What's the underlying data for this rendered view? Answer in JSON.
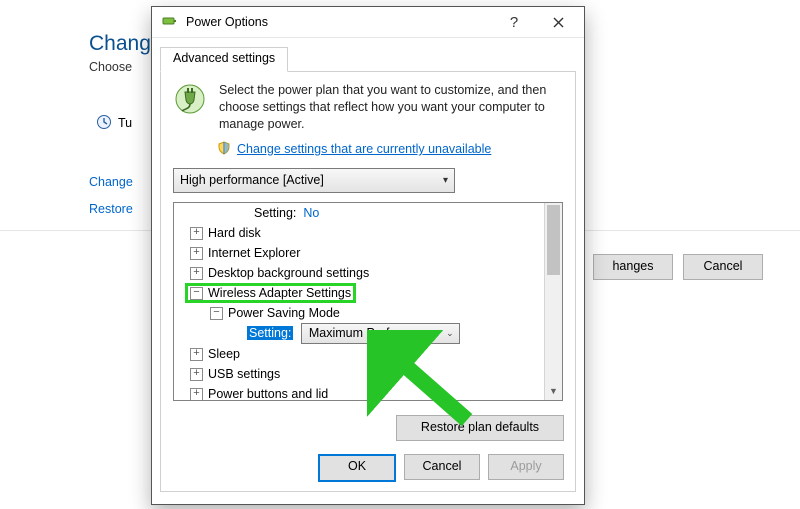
{
  "background": {
    "title": "Chang",
    "subtitle": "Choose",
    "turn_label": "Tu",
    "link_change": "Change",
    "link_restore": "Restore",
    "btn_save": "hanges",
    "btn_cancel": "Cancel"
  },
  "dialog": {
    "title": "Power Options",
    "tab": "Advanced settings",
    "description": "Select the power plan that you want to customize, and then choose settings that reflect how you want your computer to manage power.",
    "uac_link": "Change settings that are currently unavailable",
    "plan_selected": "High performance [Active]",
    "restore_btn": "Restore plan defaults",
    "ok": "OK",
    "cancel": "Cancel",
    "apply": "Apply"
  },
  "tree": {
    "row0_label": "Setting:",
    "row0_value": "No",
    "items": [
      "Hard disk",
      "Internet Explorer",
      "Desktop background settings",
      "Wireless Adapter Settings",
      "Sleep",
      "USB settings",
      "Power buttons and lid"
    ],
    "sub_power_mode": "Power Saving Mode",
    "setting_label": "Setting:",
    "setting_value": "Maximum Performance"
  }
}
